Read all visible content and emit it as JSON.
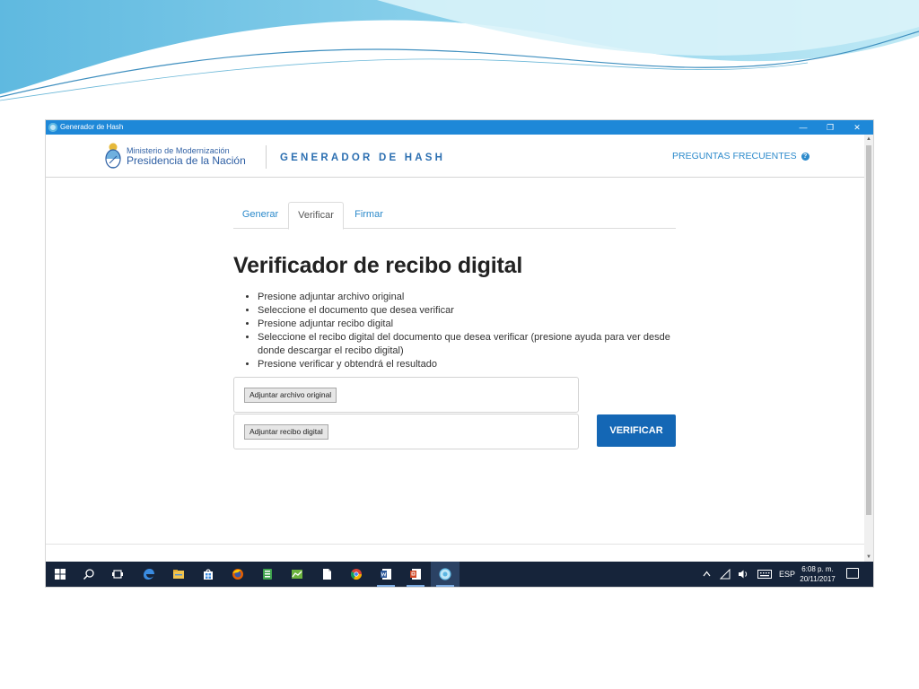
{
  "window": {
    "title": "Generador de Hash",
    "controls": {
      "minimize": "—",
      "restore": "❐",
      "close": "✕"
    }
  },
  "header": {
    "ministry_line1": "Ministerio de Modernización",
    "ministry_line2": "Presidencia de la Nación",
    "brand": "GENERADOR DE HASH",
    "faq_label": "PREGUNTAS FRECUENTES",
    "faq_icon": "?"
  },
  "tabs": [
    {
      "label": "Generar",
      "active": false
    },
    {
      "label": "Verificar",
      "active": true
    },
    {
      "label": "Firmar",
      "active": false
    }
  ],
  "main": {
    "title": "Verificador de recibo digital",
    "steps": [
      "Presione adjuntar archivo original",
      "Seleccione el documento que desea verificar",
      "Presione adjuntar recibo digital",
      "Seleccione el recibo digital del documento que desea verificar (presione ayuda para ver desde donde descargar el recibo digital)",
      "Presione verificar y obtendrá el resultado"
    ],
    "attach_original_label": "Adjuntar archivo original",
    "attach_receipt_label": "Adjuntar recibo digital",
    "verify_label": "VERIFICAR"
  },
  "taskbar": {
    "apps": [
      "start-icon",
      "search-icon",
      "task-view-icon",
      "edge-icon",
      "file-explorer-icon",
      "store-icon",
      "firefox-icon",
      "app-green-icon",
      "app-chart-icon",
      "file-icon",
      "chrome-icon",
      "word-icon",
      "powerpoint-icon",
      "hash-generator-icon"
    ],
    "tray": {
      "language": "ESP"
    },
    "clock": {
      "time": "6:08 p. m.",
      "date": "20/11/2017"
    }
  },
  "colors": {
    "titlebar": "#1e88d8",
    "brand_blue": "#2c6fb1",
    "link_blue": "#2c8acb",
    "button_blue": "#1467b5",
    "taskbar": "#16243a"
  }
}
